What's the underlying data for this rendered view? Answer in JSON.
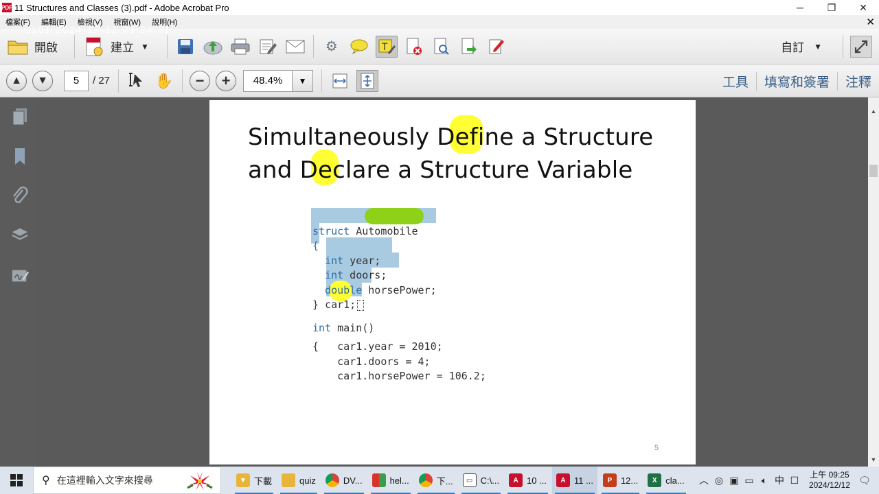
{
  "window": {
    "title": "11 Structures and Classes (3).pdf - Adobe Acrobat Pro",
    "app_icon_label": "PDF",
    "timestamp_overlay": "0101  2024-12-12  09:24:31"
  },
  "menu": {
    "items": [
      "檔案(F)",
      "編輯(E)",
      "檢視(V)",
      "視窗(W)",
      "說明(H)"
    ],
    "close_doc": "✕"
  },
  "toolbar": {
    "open_label": "開啟",
    "create_label": "建立",
    "custom_label": "自訂"
  },
  "navbar": {
    "current_page": "5",
    "total_pages": "/ 27",
    "zoom": "48.4%",
    "right_links": [
      "工具",
      "填寫和簽署",
      "注釋"
    ]
  },
  "slide": {
    "title_line1": "Simultaneously Define a Structure",
    "title_line2": "and Declare a Structure Variable",
    "code": {
      "l1_kw": "struct",
      "l1_rest": " Automobile",
      "l2": "{",
      "l3_kw": "int",
      "l3_rest": " year;",
      "l4_kw": "int",
      "l4_rest": " doors;",
      "l5_kw": "double",
      "l5_rest": " horsePower;",
      "l6_a": "} ",
      "l6_b": "car1;",
      "main_kw": "int",
      "main_rest": " main()",
      "m1": "{   car1.year = 2010;",
      "m2": "    car1.doors = 4;",
      "m3": "    car1.horsePower = 106.2;"
    },
    "page_number": "5"
  },
  "taskbar": {
    "search_placeholder": "在這裡輸入文字來搜尋",
    "items": [
      {
        "label": "下載",
        "color": "#e8b53a"
      },
      {
        "label": "quiz",
        "color": "#e8b53a"
      },
      {
        "label": "DV...",
        "color": "#3b9d4c"
      },
      {
        "label": "hel...",
        "color": "#7a3ea0"
      },
      {
        "label": "下...",
        "color": "#3b9d4c"
      },
      {
        "label": "C:\\...",
        "color": "#444444"
      },
      {
        "label": "10 ...",
        "color": "#c8102e"
      },
      {
        "label": "11 ...",
        "color": "#c8102e"
      },
      {
        "label": "12...",
        "color": "#c43e1c"
      },
      {
        "label": "cla...",
        "color": "#1e7145"
      }
    ],
    "ime": "中",
    "clock_time": "上午 09:25",
    "clock_date": "2024/12/12"
  }
}
